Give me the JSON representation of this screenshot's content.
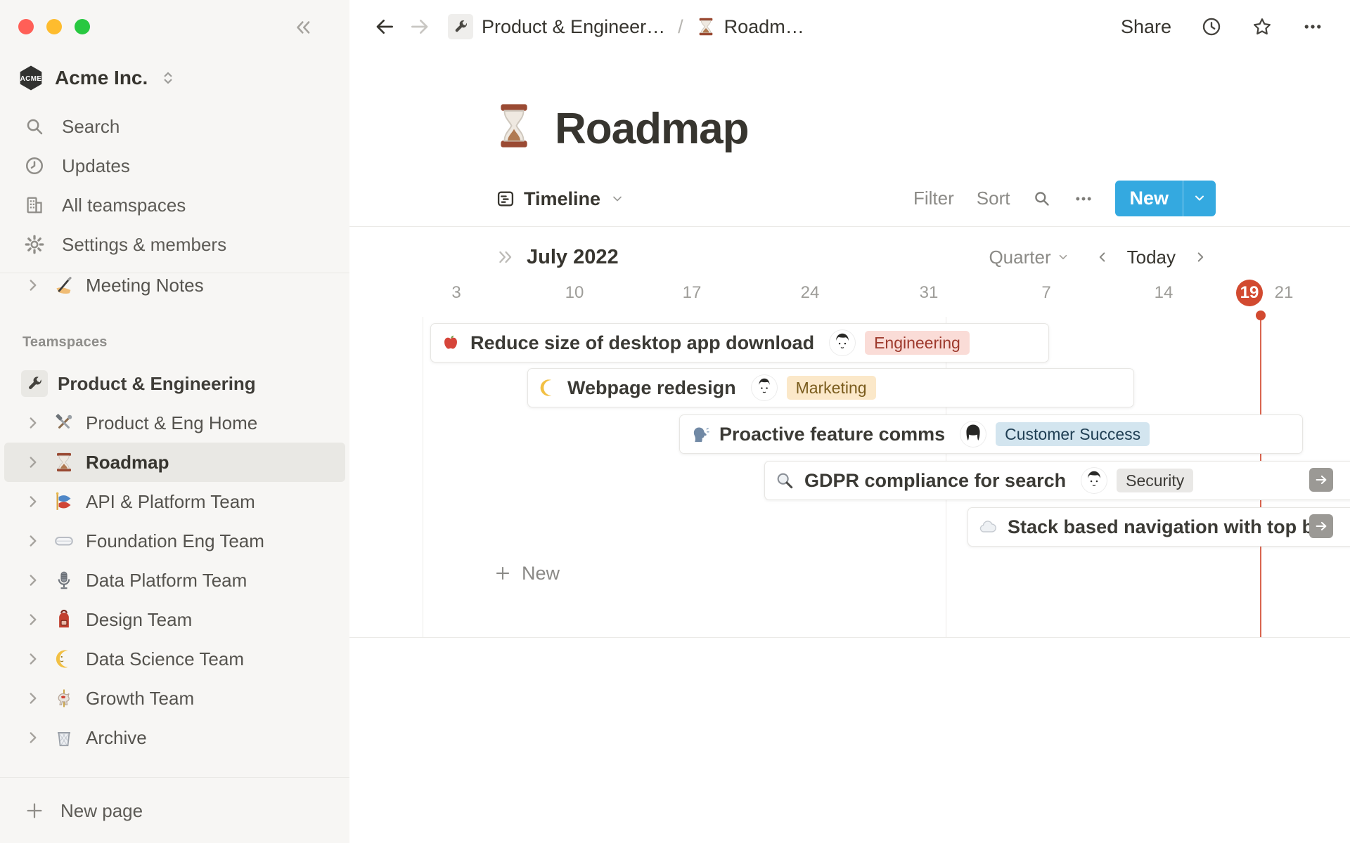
{
  "window": {
    "traffic_light_colors": [
      "#ff5f57",
      "#febc2e",
      "#28c840"
    ]
  },
  "sidebar": {
    "workspace": {
      "name": "Acme Inc.",
      "logo_text": "ACME"
    },
    "menu": [
      {
        "icon": "search-icon",
        "label": "Search"
      },
      {
        "icon": "clock-icon",
        "label": "Updates"
      },
      {
        "icon": "building-icon",
        "label": "All teamspaces"
      },
      {
        "icon": "gear-icon",
        "label": "Settings & members"
      }
    ],
    "pinned": [
      {
        "icon": "writing-hand-emoji",
        "label": "Meeting Notes"
      }
    ],
    "section_label": "Teamspaces",
    "teamspaces": [
      {
        "icon": "wrench-emoji",
        "label": "Product & Engineering"
      },
      {
        "icon": "hammer-and-wrench-emoji",
        "label": "Product & Eng Home"
      },
      {
        "icon": "hourglass-emoji",
        "label": "Roadmap",
        "selected": true
      },
      {
        "icon": "carp-streamer-emoji",
        "label": "API & Platform Team"
      },
      {
        "icon": "goggles-emoji",
        "label": "Foundation Eng Team"
      },
      {
        "icon": "microphone-emoji",
        "label": "Data Platform Team"
      },
      {
        "icon": "backpack-emoji",
        "label": "Design Team"
      },
      {
        "icon": "moon-emoji",
        "label": "Data Science Team"
      },
      {
        "icon": "carousel-emoji",
        "label": "Growth Team"
      },
      {
        "icon": "wastebasket-emoji",
        "label": "Archive"
      }
    ],
    "new_page_label": "New page"
  },
  "topbar": {
    "breadcrumb": {
      "first": "Product & Engineer…",
      "separator": "/",
      "second": "Roadm…"
    },
    "share_label": "Share"
  },
  "page": {
    "icon": "hourglass-emoji",
    "title": "Roadmap"
  },
  "view_bar": {
    "view_label": "Timeline",
    "filter_label": "Filter",
    "sort_label": "Sort",
    "new_label": "New",
    "accent_color": "#34a9e0"
  },
  "timeline": {
    "month_label": "July 2022",
    "scale_label": "Quarter",
    "today_label": "Today",
    "dates": [
      "3",
      "10",
      "17",
      "24",
      "31",
      "7",
      "14",
      "19",
      "21"
    ],
    "today_index": 7,
    "today_color": "#d24a30",
    "cards": [
      {
        "icon": "apple-emoji",
        "title": "Reduce size of desktop app download",
        "avatar": "man",
        "tag": {
          "label": "Engineering",
          "bg": "#fadcd7",
          "color": "#9d392c"
        }
      },
      {
        "icon": "crescent-moon-emoji",
        "title": "Webpage redesign",
        "avatar": "man",
        "tag": {
          "label": "Marketing",
          "bg": "#fbe8c9",
          "color": "#7a5c1d"
        }
      },
      {
        "icon": "speaking-head-emoji",
        "title": "Proactive feature comms",
        "avatar": "woman",
        "tag": {
          "label": "Customer Success",
          "bg": "#d3e5ef",
          "color": "#1f3e53"
        }
      },
      {
        "icon": "magnifier-emoji",
        "title": "GDPR compliance for search",
        "avatar": "man",
        "tag": {
          "label": "Security",
          "bg": "#e9e8e6",
          "color": "#3c3a36"
        },
        "overflow_right": true
      },
      {
        "icon": "cloud-emoji",
        "title": "Stack based navigation with top bar",
        "overflow_right": true
      }
    ],
    "add_label": "New"
  }
}
